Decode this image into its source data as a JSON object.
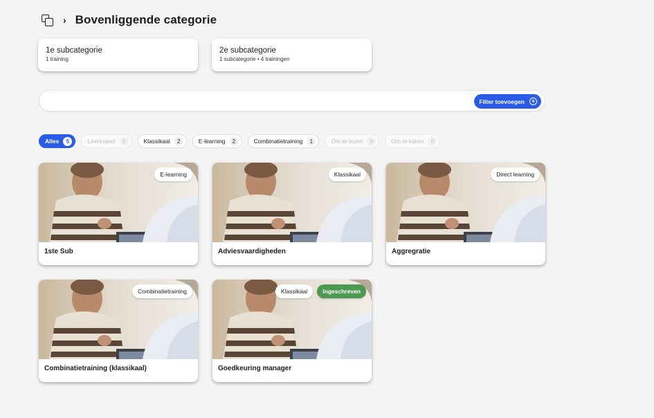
{
  "header": {
    "title": "Bovenliggende categorie",
    "icon": "copy-icon",
    "separator": "›"
  },
  "subcategories": [
    {
      "name": "1e subcategorie",
      "meta": "1 training"
    },
    {
      "name": "2e subcategorie",
      "meta": "1 subcategorie • 4 trainingen"
    }
  ],
  "search": {
    "placeholder": "",
    "filter_label": "Filter toevoegen",
    "filter_icon": "+"
  },
  "chips": [
    {
      "label": "Alles",
      "count": "5",
      "state": "active"
    },
    {
      "label": "Leertraject",
      "count": "0",
      "state": "disabled"
    },
    {
      "label": "Klassikaal",
      "count": "2",
      "state": "normal"
    },
    {
      "label": "E-learning",
      "count": "2",
      "state": "normal"
    },
    {
      "label": "Combinatietraining",
      "count": "1",
      "state": "normal"
    },
    {
      "label": "Om te lezen",
      "count": "0",
      "state": "disabled"
    },
    {
      "label": "Om te kijken",
      "count": "0",
      "state": "disabled"
    }
  ],
  "cards": [
    {
      "title": "1ste Sub",
      "badges": [
        "E-learning"
      ]
    },
    {
      "title": "Adviesvaardigheden",
      "badges": [
        "Klassikaal"
      ]
    },
    {
      "title": "Aggregratie",
      "badges": [
        "Direct learning"
      ]
    },
    {
      "title": "Combinatietraining (klassikaal)",
      "badges": [
        "Combinatietraining"
      ]
    },
    {
      "title": "Goedkeuring manager",
      "badges": [
        "Klassikaal"
      ],
      "status": "Ingeschreven"
    }
  ],
  "colors": {
    "accent": "#2a5ce6",
    "enrolled": "#4c9a52",
    "background": "#f4f4f4"
  }
}
